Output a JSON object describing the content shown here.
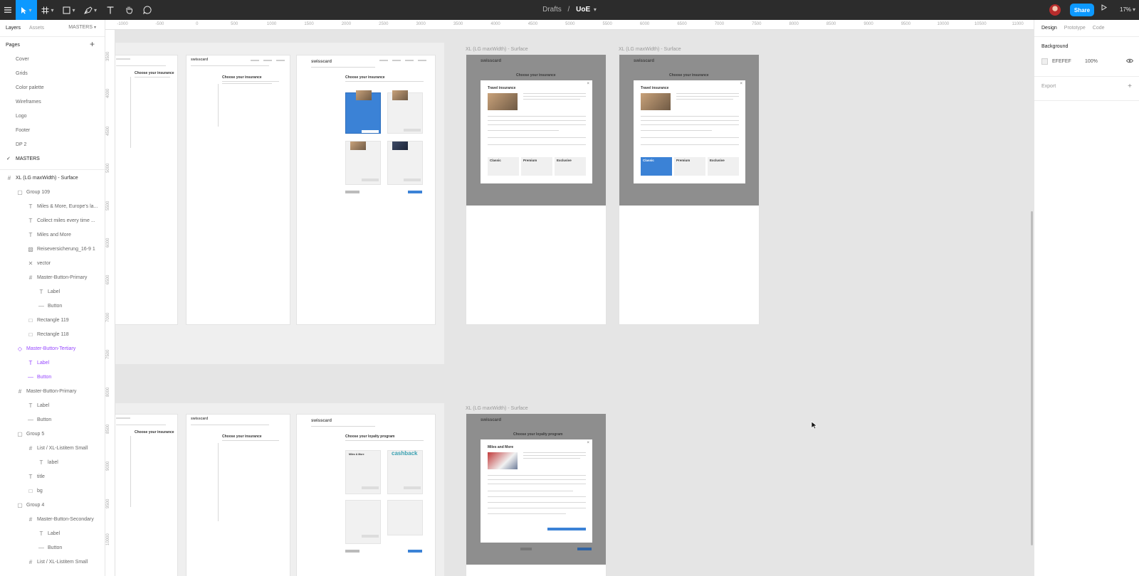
{
  "toolbar": {
    "file_project": "Drafts",
    "separator": "/",
    "file_name": "UoE",
    "share_label": "Share",
    "zoom": "17%"
  },
  "left_panel": {
    "tabs": [
      "Layers",
      "Assets"
    ],
    "page_select": "MASTERS",
    "pages_heading": "Pages",
    "pages": [
      {
        "label": "Cover",
        "checked": false
      },
      {
        "label": "Grids",
        "checked": false
      },
      {
        "label": "Color palette",
        "checked": false
      },
      {
        "label": "Wireframes",
        "checked": false
      },
      {
        "label": "Logo",
        "checked": false
      },
      {
        "label": "Footer",
        "checked": false
      },
      {
        "label": "DP 2",
        "checked": false
      },
      {
        "label": "MASTERS",
        "checked": true
      }
    ],
    "layers": [
      {
        "label": "XL (LG maxWidth) - Surface",
        "indent": 0,
        "icon": "frame-icon",
        "style": ""
      },
      {
        "label": "Group 109",
        "indent": 1,
        "icon": "group-icon",
        "style": ""
      },
      {
        "label": "Miles & More, Europe's la...",
        "indent": 2,
        "icon": "text-icon",
        "style": ""
      },
      {
        "label": "Collect miles every time ...",
        "indent": 2,
        "icon": "text-icon",
        "style": ""
      },
      {
        "label": "Miles and More",
        "indent": 2,
        "icon": "text-icon",
        "style": ""
      },
      {
        "label": "Reiseversicherung_16-9 1",
        "indent": 2,
        "icon": "image-icon",
        "style": ""
      },
      {
        "label": "vector",
        "indent": 2,
        "icon": "vector-icon",
        "style": ""
      },
      {
        "label": "Master-Button-Primary",
        "indent": 2,
        "icon": "frame-icon",
        "style": ""
      },
      {
        "label": "Label",
        "indent": 3,
        "icon": "text-icon",
        "style": ""
      },
      {
        "label": "Button",
        "indent": 3,
        "icon": "line-icon",
        "style": ""
      },
      {
        "label": "Rectangle 119",
        "indent": 2,
        "icon": "rectangle-icon",
        "style": ""
      },
      {
        "label": "Rectangle 118",
        "indent": 2,
        "icon": "rectangle-icon",
        "style": ""
      },
      {
        "label": "Master-Button-Tertiary",
        "indent": 1,
        "icon": "component-icon",
        "style": "purple"
      },
      {
        "label": "Label",
        "indent": 2,
        "icon": "text-icon",
        "style": "purple"
      },
      {
        "label": "Button",
        "indent": 2,
        "icon": "line-icon",
        "style": "purple"
      },
      {
        "label": "Master-Button-Primary",
        "indent": 1,
        "icon": "frame-icon",
        "style": ""
      },
      {
        "label": "Label",
        "indent": 2,
        "icon": "text-icon",
        "style": ""
      },
      {
        "label": "Button",
        "indent": 2,
        "icon": "line-icon",
        "style": ""
      },
      {
        "label": "Group 5",
        "indent": 1,
        "icon": "group-icon",
        "style": ""
      },
      {
        "label": "List / XL-Listitem Small",
        "indent": 2,
        "icon": "frame-icon",
        "style": ""
      },
      {
        "label": "label",
        "indent": 3,
        "icon": "text-icon",
        "style": ""
      },
      {
        "label": "title",
        "indent": 2,
        "icon": "text-icon",
        "style": ""
      },
      {
        "label": "bg",
        "indent": 2,
        "icon": "rectangle-icon",
        "style": ""
      },
      {
        "label": "Group 4",
        "indent": 1,
        "icon": "group-icon",
        "style": ""
      },
      {
        "label": "Master-Button-Secondary",
        "indent": 2,
        "icon": "frame-icon",
        "style": ""
      },
      {
        "label": "Label",
        "indent": 3,
        "icon": "text-icon",
        "style": ""
      },
      {
        "label": "Button",
        "indent": 3,
        "icon": "line-icon",
        "style": ""
      },
      {
        "label": "List / XL-Listitem Small",
        "indent": 2,
        "icon": "frame-icon",
        "style": ""
      }
    ]
  },
  "ruler": {
    "top_ticks": [
      "-1000",
      "-500",
      "0",
      "500",
      "1000",
      "1500",
      "2000",
      "2500",
      "3000",
      "3500",
      "4000",
      "4500",
      "5000",
      "5500",
      "6000",
      "6500",
      "7000",
      "7500",
      "8000",
      "8500",
      "9000",
      "9500",
      "10000",
      "10500",
      "11000"
    ],
    "left_ticks": [
      "3500",
      "4000",
      "4500",
      "5000",
      "5500",
      "6000",
      "6500",
      "7000",
      "7500",
      "8000",
      "8500",
      "9000",
      "9500",
      "10000"
    ]
  },
  "canvas": {
    "frame_titles": {
      "top_modal_1": "XL (LG maxWidth) - Surface",
      "top_modal_2": "XL (LG maxWidth) - Surface",
      "bottom_modal": "XL (LG maxWidth) - Surface"
    },
    "frame_texts": {
      "choose_insurance": "Choose your insurance",
      "choose_loyalty": "Choose your loyalty program",
      "travel_insurance": "Travel insurance",
      "miles_and_more": "Miles and More",
      "cashback": "cashback",
      "logo": "swisscard",
      "tier_classic": "Classic",
      "tier_premium": "Premium",
      "tier_exclusive": "Exclusive",
      "mm_brand": "Miles & More"
    },
    "accent_color": "#3b82d6",
    "overlay_color": "#8e8e8e"
  },
  "right_panel": {
    "tabs": [
      "Design",
      "Prototype",
      "Code"
    ],
    "background_heading": "Background",
    "background_hex": "EFEFEF",
    "background_opacity": "100%",
    "export_heading": "Export"
  }
}
